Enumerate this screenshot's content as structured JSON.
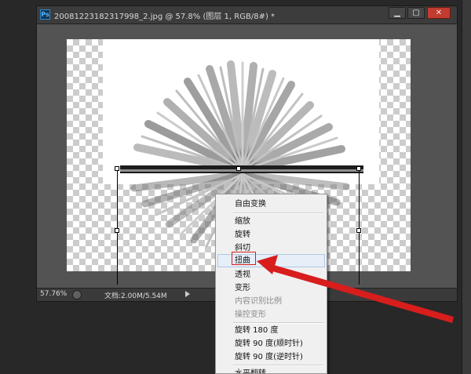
{
  "window": {
    "title": "20081223182317998_2.jpg @ 57.8% (图层 1, RGB/8#) *",
    "app_icon": "Ps",
    "minimize_glyph": "▁",
    "restore_glyph": "▢",
    "close_glyph": "✕"
  },
  "status": {
    "zoom": "57.76%",
    "doc_info": "文档:2.00M/5.54M"
  },
  "context_menu": {
    "items": [
      {
        "label": "自由变换",
        "enabled": true
      },
      {
        "label": "缩放",
        "enabled": true
      },
      {
        "label": "旋转",
        "enabled": true
      },
      {
        "label": "斜切",
        "enabled": true
      },
      {
        "label": "扭曲",
        "enabled": true,
        "highlighted": true
      },
      {
        "label": "透视",
        "enabled": true
      },
      {
        "label": "变形",
        "enabled": true
      },
      {
        "label": "内容识别比例",
        "enabled": false
      },
      {
        "label": "操控变形",
        "enabled": false
      },
      {
        "label": "旋转 180 度",
        "enabled": true
      },
      {
        "label": "旋转 90 度(顺时针)",
        "enabled": true
      },
      {
        "label": "旋转 90 度(逆时针)",
        "enabled": true
      },
      {
        "label": "水平翻转",
        "enabled": true
      }
    ]
  },
  "colors": {
    "annotation": "#d81d1d",
    "menu_highlight": "#e6eef8"
  }
}
